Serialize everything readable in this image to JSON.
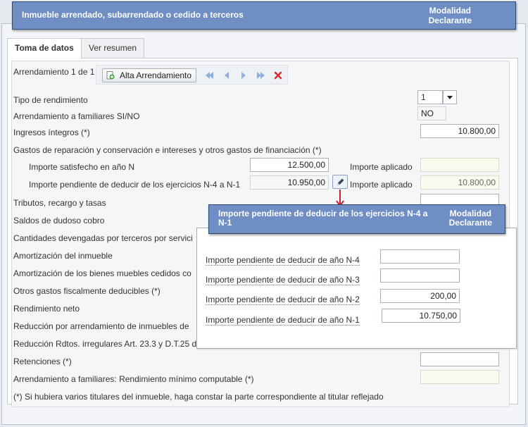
{
  "header": {
    "title": "Inmueble arrendado, subarrendado o cedido a terceros",
    "modalidad_line1": "Modalidad",
    "modalidad_line2": "Declarante"
  },
  "tabs": [
    {
      "label": "Toma de datos",
      "active": true
    },
    {
      "label": "Ver resumen",
      "active": false
    }
  ],
  "record": {
    "label": "Arrendamiento 1 de 1",
    "alta_button": "Alta Arrendamiento"
  },
  "form": {
    "tipo_rendimiento": {
      "label": "Tipo de rendimiento",
      "value": "1"
    },
    "familiares": {
      "label": "Arrendamiento a familiares SI/NO",
      "value": "NO"
    },
    "ingresos": {
      "label": "Ingresos íntegros (*)",
      "value": "10.800,00"
    },
    "gastos_titulo": "Gastos de reparación y conservación e intereses y otros gastos de financiación (*)",
    "importe_satisfecho": {
      "label": "Importe satisfecho en año N",
      "value": "12.500,00"
    },
    "importe_pendiente": {
      "label": "Importe pendiente de deducir de los ejercicios N-4 a N-1",
      "value": "10.950,00"
    },
    "importe_aplicado_1": {
      "label": "Importe aplicado",
      "value": ""
    },
    "importe_aplicado_2": {
      "label": "Importe aplicado",
      "value": "10.800,00"
    },
    "tributos": "Tributos, recargo y tasas",
    "saldos": "Saldos de dudoso cobro",
    "cantidades": "Cantidades devengadas por terceros por servici",
    "amort_inmueble": "Amortización del inmueble",
    "amort_bienes": "Amortización de los bienes muebles cedidos co",
    "otros_gastos": "Otros gastos fiscalmente deducibles (*)",
    "rendimiento_neto": "Rendimiento neto",
    "reduccion_arrend": "Reducción por arrendamiento de inmuebles de",
    "reduccion_rdtos": "Reducción Rdtos. irregulares Art. 23.3 y D.T.25 d",
    "retenciones": {
      "label": "Retenciones (*)",
      "value": ""
    },
    "rend_minimo": {
      "label": "Arrendamiento a familiares: Rendimiento mínimo computable (*)",
      "value": ""
    },
    "nota": "(*) Si hubiera varios titulares del inmueble, haga constar la parte correspondiente al titular reflejado"
  },
  "popup": {
    "title": "Importe pendiente de deducir de los ejercicios N-4 a N-1",
    "modalidad_line1": "Modalidad",
    "modalidad_line2": "Declarante",
    "rows": [
      {
        "label": "Importe pendiente de deducir de año N-4",
        "value": ""
      },
      {
        "label": "Importe pendiente de deducir de año N-3",
        "value": ""
      },
      {
        "label": "Importe pendiente de deducir de año N-2",
        "value": "200,00"
      },
      {
        "label": "Importe pendiente de deducir de año N-1",
        "value": "10.750,00"
      }
    ]
  },
  "colors": {
    "header_bg": "#6f8ec4",
    "header_border": "#2e4770",
    "arrow_red": "#d0202a",
    "delete_red": "#d0302a",
    "nav_blue": "#8fb0de"
  },
  "icons": [
    "add-record-icon",
    "first-icon",
    "previous-icon",
    "next-icon",
    "last-icon",
    "delete-icon",
    "pencil-icon",
    "down-arrow-icon"
  ]
}
